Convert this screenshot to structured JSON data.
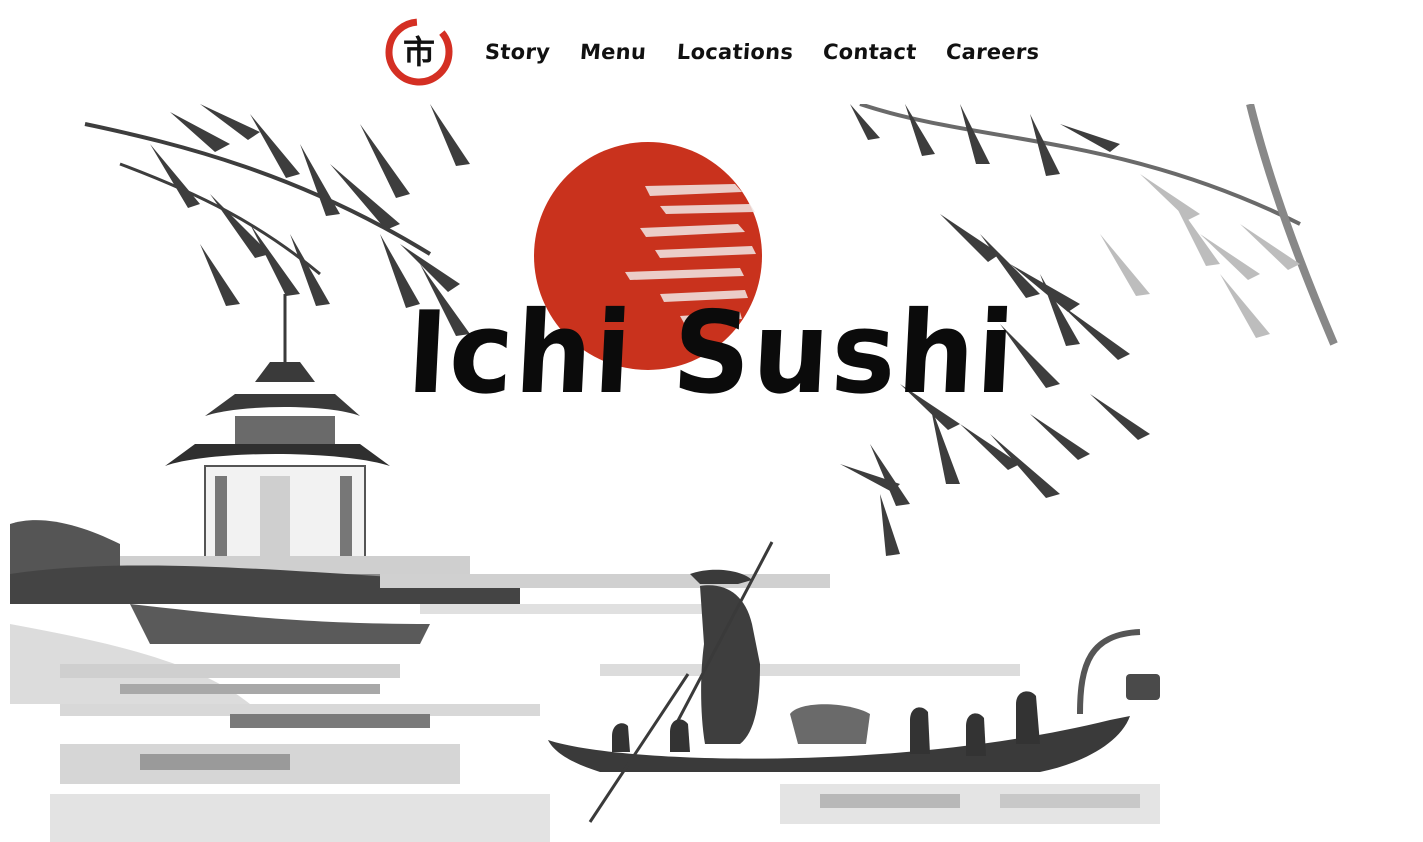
{
  "brand": {
    "logo_icon": "kanji-ichi-logo-icon",
    "logo_glyph": "市",
    "accent": "#d42f23"
  },
  "nav": {
    "items": [
      {
        "label": "Story"
      },
      {
        "label": "Menu"
      },
      {
        "label": "Locations"
      },
      {
        "label": "Contact"
      },
      {
        "label": "Careers"
      }
    ]
  },
  "hero": {
    "title": "Ichi Sushi",
    "sun_color": "#c9321d",
    "illustration": "ink-wash-landscape"
  }
}
